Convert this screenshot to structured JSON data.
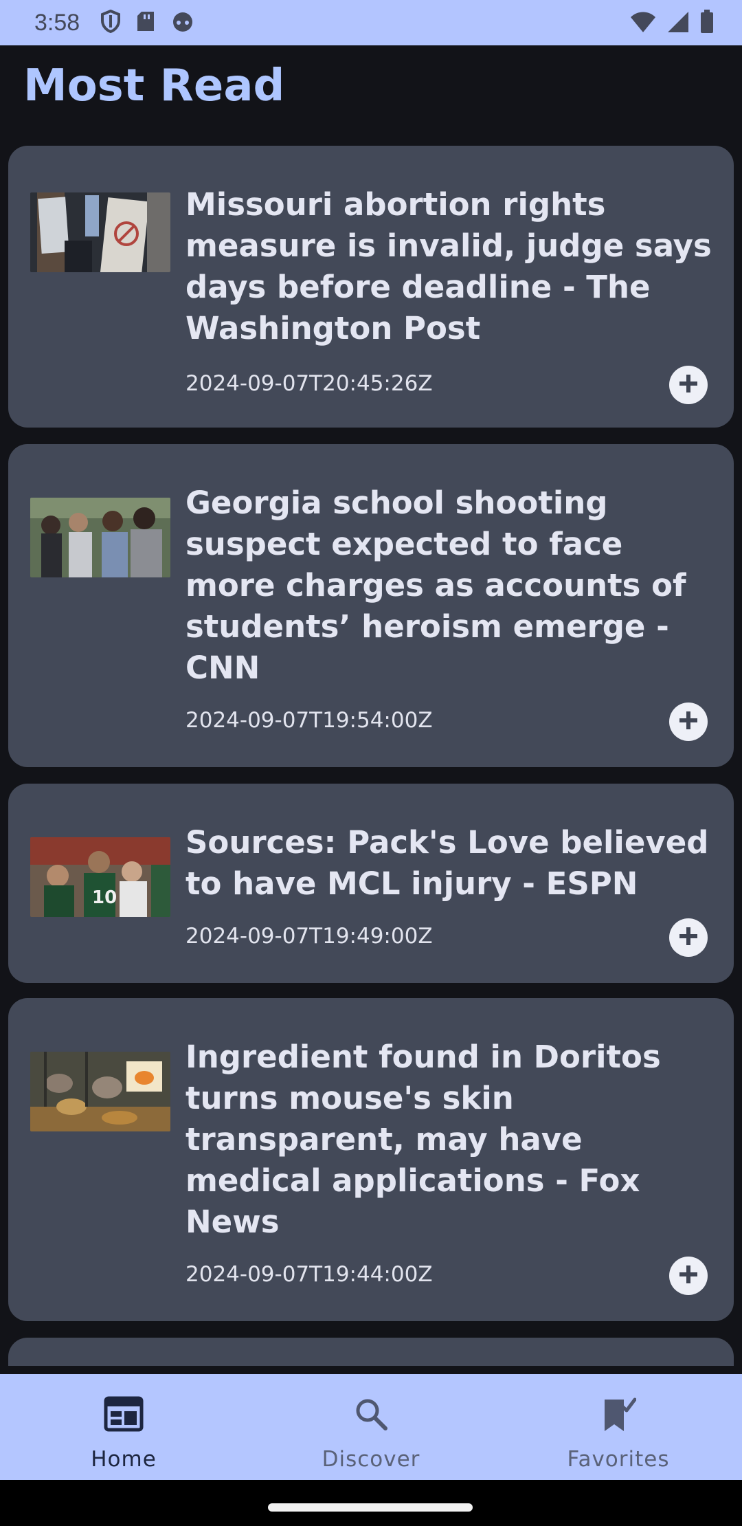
{
  "status_bar": {
    "time": "3:58",
    "left_icons": [
      "shield-icon",
      "sd-card-icon",
      "android-face-icon"
    ],
    "right_icons": [
      "wifi-icon",
      "cell-signal-icon",
      "battery-icon"
    ]
  },
  "page": {
    "title": "Most Read"
  },
  "articles": [
    {
      "title": "Missouri abortion rights measure is invalid, judge says days before deadline - The Washington Post",
      "date": "2024-09-07T20:45:26Z",
      "thumbnail": "protest-signs-photo"
    },
    {
      "title": "Georgia school shooting suspect expected to face more charges as accounts of students’ heroism emerge - CNN",
      "date": "2024-09-07T19:54:00Z",
      "thumbnail": "people-hugging-photo"
    },
    {
      "title": "Sources: Pack's Love believed to have MCL injury - ESPN",
      "date": "2024-09-07T19:49:00Z",
      "thumbnail": "football-players-photo"
    },
    {
      "title": "Ingredient found in Doritos turns mouse's skin transparent, may have medical applications - Fox News",
      "date": "2024-09-07T19:44:00Z",
      "thumbnail": "mouse-photo"
    }
  ],
  "bottom_nav": {
    "items": [
      {
        "label": "Home",
        "icon": "home-news-icon",
        "active": true
      },
      {
        "label": "Discover",
        "icon": "search-icon",
        "active": false
      },
      {
        "label": "Favorites",
        "icon": "bookmark-check-icon",
        "active": false
      }
    ]
  },
  "colors": {
    "accent": "#aec6ff",
    "background": "#121318",
    "card": "#434958",
    "nav_bar": "#b4c6ff"
  }
}
